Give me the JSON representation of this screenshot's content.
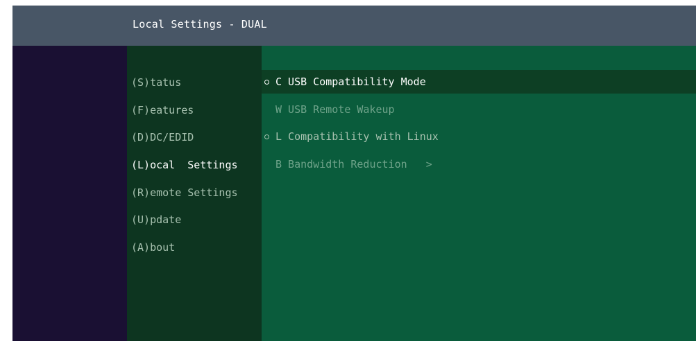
{
  "header": {
    "title": "Local Settings - DUAL"
  },
  "menu": {
    "items": [
      {
        "label": "(S)tatus"
      },
      {
        "label": "(F)eatures"
      },
      {
        "label": "(D)DC/EDID"
      },
      {
        "label": "(L)ocal  Settings"
      },
      {
        "label": "(R)emote Settings"
      },
      {
        "label": "(U)pdate"
      },
      {
        "label": "(A)bout"
      }
    ],
    "active_index": 3
  },
  "options": [
    {
      "label": "C USB Compatibility Mode",
      "checked": true,
      "selected": true
    },
    {
      "label": "W USB Remote Wakeup",
      "checked": false,
      "selected": false
    },
    {
      "label": "L Compatibility with Linux",
      "checked": true,
      "selected": false
    },
    {
      "label": "B Bandwidth Reduction   >",
      "checked": false,
      "selected": false
    }
  ],
  "colors": {
    "titlebar": "#485666",
    "left_panel": "#1a1033",
    "menu_bg": "#0d3520",
    "content_bg": "#0a5c3c",
    "selected_row": "#0d3f24"
  }
}
